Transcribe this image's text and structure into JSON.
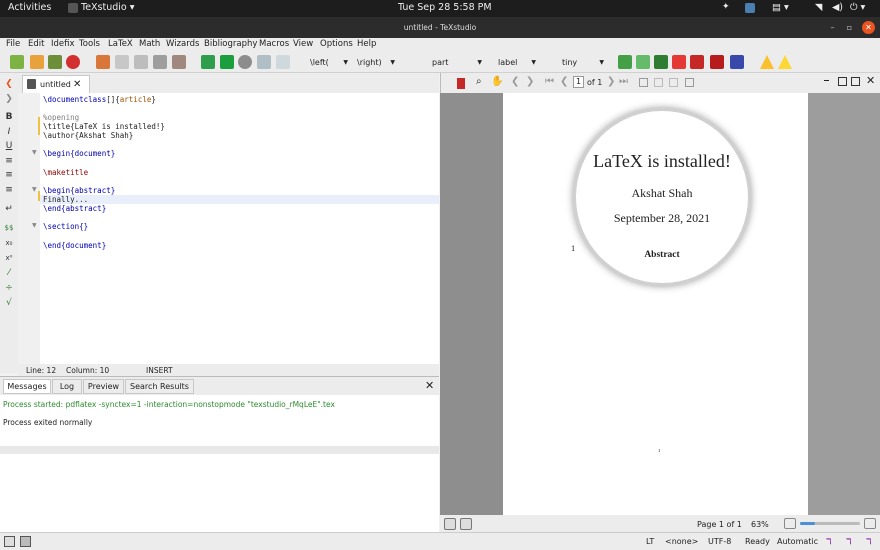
{
  "topbar": {
    "activities": "Activities",
    "app": "TeXstudio ▾",
    "datetime": "Tue Sep 28   5:58 PM"
  },
  "window": {
    "title": "untitled - TeXstudio"
  },
  "menu": [
    "File",
    "Edit",
    "Idefix",
    "Tools",
    "LaTeX",
    "Math",
    "Wizards",
    "Bibliography",
    "Macros",
    "View",
    "Options",
    "Help"
  ],
  "toolbar": {
    "left_delim": "\\left(",
    "right_delim": "\\right)",
    "sectioning": "part",
    "ref": "label",
    "size": "tiny"
  },
  "tab": {
    "label": "untitled"
  },
  "code": [
    {
      "n": "",
      "t": "\\documentclass[]{article}"
    },
    {
      "n": "",
      "t": ""
    },
    {
      "n": "",
      "t": "%opening"
    },
    {
      "n": "",
      "t": "\\title{LaTeX is installed!}"
    },
    {
      "n": "",
      "t": "\\author{Akshat Shah}"
    },
    {
      "n": "",
      "t": ""
    },
    {
      "n": "",
      "t": "\\begin{document}"
    },
    {
      "n": "",
      "t": ""
    },
    {
      "n": "",
      "t": "\\maketitle"
    },
    {
      "n": "",
      "t": ""
    },
    {
      "n": "",
      "t": "\\begin{abstract}"
    },
    {
      "n": "",
      "t": "Finally..."
    },
    {
      "n": "",
      "t": "\\end{abstract}"
    },
    {
      "n": "",
      "t": ""
    },
    {
      "n": "",
      "t": "\\section{}"
    },
    {
      "n": "",
      "t": ""
    },
    {
      "n": "",
      "t": "\\end{document}"
    }
  ],
  "editor_status": {
    "line": "Line: 12",
    "column": "Column: 10",
    "mode": "INSERT"
  },
  "messages": {
    "tabs": [
      "Messages",
      "Log",
      "Preview",
      "Search Results"
    ],
    "started": "Process started: pdflatex -synctex=1 -interaction=nonstopmode \"texstudio_rMqLeE\".tex",
    "exited": "Process exited normally"
  },
  "pdf": {
    "page_input": "1",
    "of": "of 1",
    "title": "LaTeX is installed!",
    "author": "Akshat Shah",
    "date": "September 28, 2021",
    "abstract": "Abstract",
    "margin_num": "1",
    "footer_num": "1",
    "page_status": "Page 1 of 1",
    "zoom": "63%",
    "zoom_fill": 0.25
  },
  "statusbar": {
    "lt": "LT",
    "lang": "<none>",
    "enc": "UTF-8",
    "ready": "Ready",
    "auto": "Automatic"
  }
}
